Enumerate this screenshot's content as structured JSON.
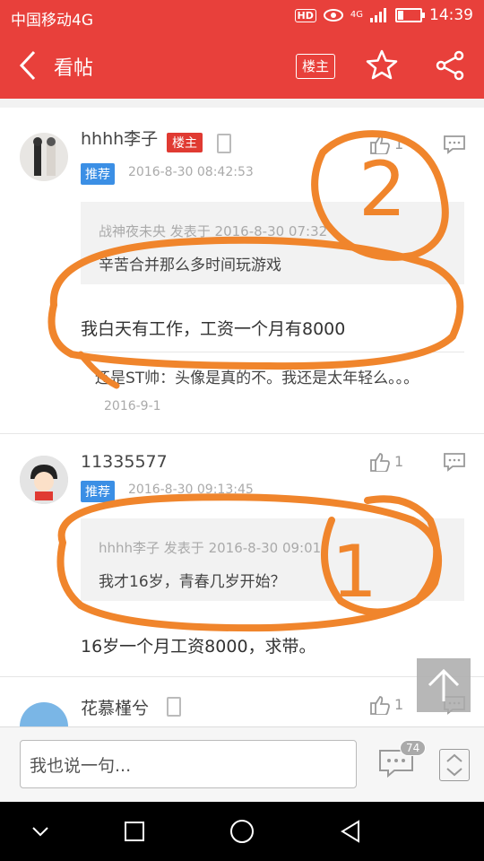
{
  "status_bar": {
    "carrier": "中国移动4G",
    "hd": "HD",
    "network": "4G",
    "time": "14:39",
    "battery_level": 0.25
  },
  "top_bar": {
    "title": "看帖",
    "host_button": "楼主",
    "icons": [
      "back-icon",
      "star-icon",
      "share-icon"
    ]
  },
  "posts": [
    {
      "username": "hhhh李子",
      "host_tag": "楼主",
      "rec_tag": "推荐",
      "time": "2016-8-30 08:42:53",
      "likes": "1",
      "quote_meta": "战神夜未央 发表于 2016-8-30 07:32",
      "quote_text": "辛苦合并那么多时间玩游戏",
      "body": "我白天有工作，工资一个月有8000",
      "sub_reply": {
        "text": "还是ST帅：头像是真的不。我还是太年轻么。。。",
        "time": "2016-9-1"
      }
    },
    {
      "username": "11335577",
      "rec_tag": "推荐",
      "time": "2016-8-30 09:13:45",
      "likes": "1",
      "quote_meta": "hhhh李子 发表于 2016-8-30 09:01",
      "quote_text": "我才16岁，青春几岁开始？",
      "body": "16岁一个月工资8000，求带。"
    },
    {
      "username": "花慕槿兮",
      "likes": "1"
    }
  ],
  "annotations": [
    "2",
    "1"
  ],
  "bottom_bar": {
    "placeholder": "我也说一句...",
    "comment_count": "74"
  },
  "colors": {
    "brand_red": "#e8403b",
    "rec_blue": "#3b8fe5",
    "annotation_orange": "#f0852c"
  }
}
